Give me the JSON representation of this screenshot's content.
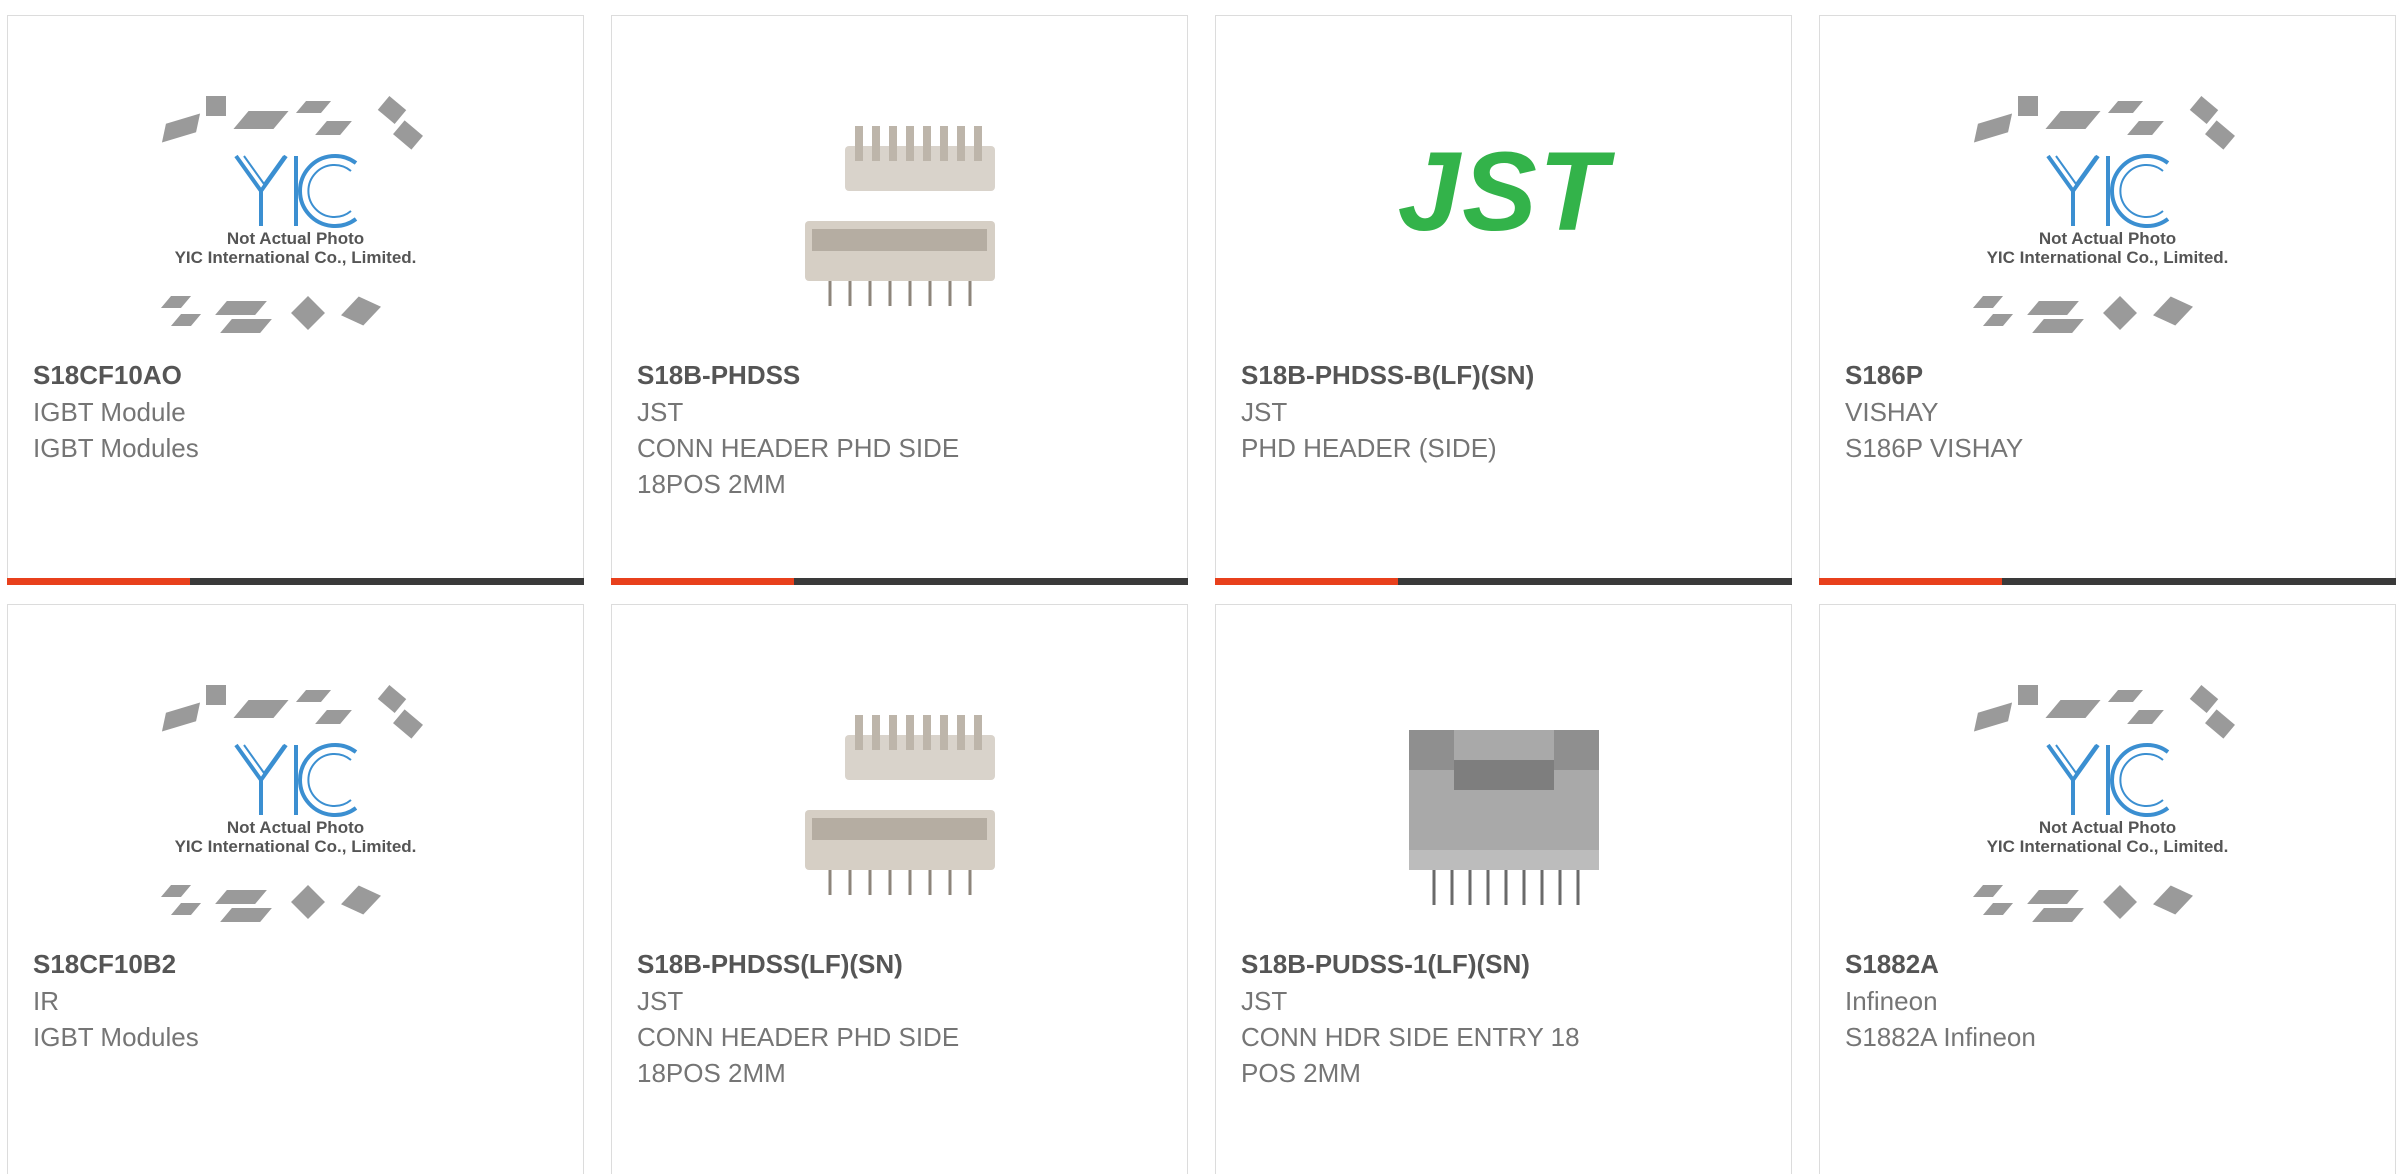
{
  "placeholder": {
    "line1": "Not Actual Photo",
    "line2": "YIC International Co., Limited."
  },
  "logo_text": "JST",
  "colors": {
    "accent": "#e8401c",
    "bar": "#3a3a3a",
    "jst_green": "#33b34a",
    "yic_blue": "#3b8fd1"
  },
  "products": [
    {
      "part": "S18CF10AO",
      "line1": "IGBT Module",
      "line2": "IGBT Modules",
      "image": "placeholder"
    },
    {
      "part": "S18B-PHDSS",
      "line1": "JST",
      "line2": "CONN HEADER PHD SIDE",
      "line3": "18POS 2MM",
      "image": "header-photo"
    },
    {
      "part": "S18B-PHDSS-B(LF)(SN)",
      "line1": "JST",
      "line2": "PHD HEADER (SIDE)",
      "image": "jst-logo"
    },
    {
      "part": "S186P",
      "line1": "VISHAY",
      "line2": "S186P VISHAY",
      "image": "placeholder"
    },
    {
      "part": "S18CF10B2",
      "line1": "IR",
      "line2": "IGBT Modules",
      "image": "placeholder"
    },
    {
      "part": "S18B-PHDSS(LF)(SN)",
      "line1": "JST",
      "line2": "CONN HEADER PHD SIDE",
      "line3": "18POS 2MM",
      "image": "header-photo"
    },
    {
      "part": "S18B-PUDSS-1(LF)(SN)",
      "line1": "JST",
      "line2": "CONN HDR SIDE ENTRY 18",
      "line3": "POS 2MM",
      "image": "connector-photo"
    },
    {
      "part": "S1882A",
      "line1": "Infineon",
      "line2": "S1882A Infineon",
      "image": "placeholder"
    }
  ]
}
